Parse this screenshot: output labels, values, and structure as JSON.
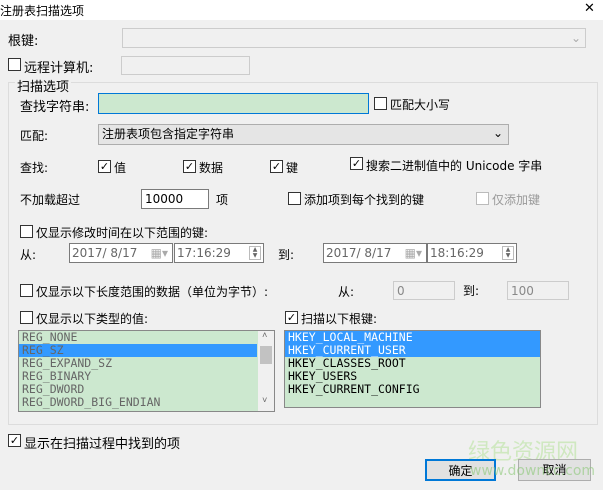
{
  "window": {
    "title": "注册表扫描选项",
    "close": "✕"
  },
  "root_key": {
    "label": "根键:",
    "value": ""
  },
  "remote": {
    "label": "远程计算机:",
    "checked": false,
    "value": ""
  },
  "group": {
    "label": "扫描选项"
  },
  "find": {
    "label": "查找字符串:",
    "value": "",
    "match_case_label": "匹配大小写",
    "match_case": false
  },
  "match": {
    "label": "匹配:",
    "value": "注册表项包含指定字符串"
  },
  "search": {
    "label": "查找:",
    "value_label": "值",
    "data_label": "数据",
    "key_label": "键",
    "unicode_label": "搜索二进制值中的 Unicode 字串"
  },
  "limit": {
    "label": "不加载超过",
    "value": "10000",
    "unit": "项",
    "add_item_label": "添加项到每个找到的键",
    "add_key_only_label": "仅添加键"
  },
  "time_range": {
    "label": "仅显示修改时间在以下范围的键:",
    "from_label": "从:",
    "to_label": "到:",
    "from_date": "2017/  8/17",
    "from_time": "17:16:29",
    "to_date": "2017/  8/17",
    "to_time": "18:16:29"
  },
  "length_range": {
    "label": "仅显示以下长度范围的数据（单位为字节）:",
    "from_label": "从:",
    "to_label": "到:",
    "from": "0",
    "to": "100"
  },
  "types": {
    "label": "仅显示以下类型的值:",
    "items": [
      "REG_NONE",
      "REG_SZ",
      "REG_EXPAND_SZ",
      "REG_BINARY",
      "REG_DWORD",
      "REG_DWORD_BIG_ENDIAN"
    ],
    "selected": [
      1
    ]
  },
  "roots": {
    "label": "扫描以下根键:",
    "items": [
      "HKEY_LOCAL_MACHINE",
      "HKEY_CURRENT_USER",
      "HKEY_CLASSES_ROOT",
      "HKEY_USERS",
      "HKEY_CURRENT_CONFIG"
    ],
    "selected": [
      0,
      1
    ]
  },
  "show_found": {
    "label": "显示在扫描过程中找到的项"
  },
  "buttons": {
    "ok": "确定",
    "cancel": "取消"
  },
  "watermark": {
    "text": "绿色资源网",
    "url": "www.downcc.com"
  }
}
